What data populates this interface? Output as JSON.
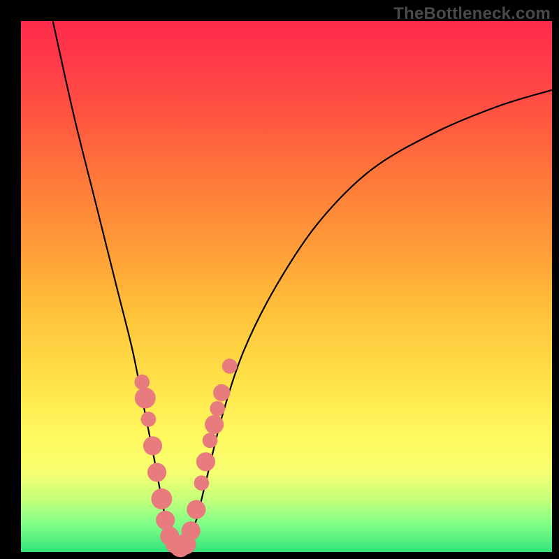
{
  "watermark": "TheBottleneck.com",
  "colors": {
    "frame": "#000000",
    "curve": "#000000",
    "marker": "#e77b7e",
    "gradient_top": "#ff2a4a",
    "gradient_bottom": "#34e27a"
  },
  "chart_data": {
    "type": "line",
    "title": "",
    "xlabel": "",
    "ylabel": "",
    "xlim": [
      0,
      100
    ],
    "ylim": [
      0,
      100
    ],
    "annotations": [],
    "series": [
      {
        "name": "bottleneck-curve",
        "points": [
          {
            "x": 6,
            "y": 100
          },
          {
            "x": 10,
            "y": 82
          },
          {
            "x": 14,
            "y": 66
          },
          {
            "x": 18,
            "y": 50
          },
          {
            "x": 21,
            "y": 38
          },
          {
            "x": 23,
            "y": 28
          },
          {
            "x": 25,
            "y": 18
          },
          {
            "x": 26.5,
            "y": 10
          },
          {
            "x": 27.5,
            "y": 5
          },
          {
            "x": 28.5,
            "y": 2
          },
          {
            "x": 30,
            "y": 1
          },
          {
            "x": 31.5,
            "y": 2
          },
          {
            "x": 33,
            "y": 6
          },
          {
            "x": 35,
            "y": 14
          },
          {
            "x": 38,
            "y": 26
          },
          {
            "x": 42,
            "y": 38
          },
          {
            "x": 48,
            "y": 50
          },
          {
            "x": 56,
            "y": 62
          },
          {
            "x": 66,
            "y": 72
          },
          {
            "x": 78,
            "y": 79
          },
          {
            "x": 90,
            "y": 84
          },
          {
            "x": 100,
            "y": 87
          }
        ]
      }
    ],
    "markers": [
      {
        "x": 22.8,
        "y": 32,
        "r": 1.0
      },
      {
        "x": 23.4,
        "y": 29,
        "r": 1.6
      },
      {
        "x": 24.0,
        "y": 25,
        "r": 1.0
      },
      {
        "x": 24.8,
        "y": 20,
        "r": 1.4
      },
      {
        "x": 25.6,
        "y": 15,
        "r": 1.4
      },
      {
        "x": 26.5,
        "y": 10,
        "r": 1.6
      },
      {
        "x": 27.2,
        "y": 6,
        "r": 1.4
      },
      {
        "x": 28.0,
        "y": 3,
        "r": 1.4
      },
      {
        "x": 29.0,
        "y": 1.5,
        "r": 1.4
      },
      {
        "x": 30.0,
        "y": 1,
        "r": 1.6
      },
      {
        "x": 31.0,
        "y": 1.5,
        "r": 1.6
      },
      {
        "x": 32.0,
        "y": 4,
        "r": 1.4
      },
      {
        "x": 33.0,
        "y": 8,
        "r": 1.4
      },
      {
        "x": 34.0,
        "y": 13,
        "r": 1.0
      },
      {
        "x": 34.8,
        "y": 17,
        "r": 1.4
      },
      {
        "x": 35.6,
        "y": 21,
        "r": 1.0
      },
      {
        "x": 36.4,
        "y": 24,
        "r": 1.4
      },
      {
        "x": 37.0,
        "y": 27,
        "r": 1.0
      },
      {
        "x": 37.8,
        "y": 30,
        "r": 1.2
      },
      {
        "x": 39.3,
        "y": 35,
        "r": 1.0
      }
    ]
  }
}
